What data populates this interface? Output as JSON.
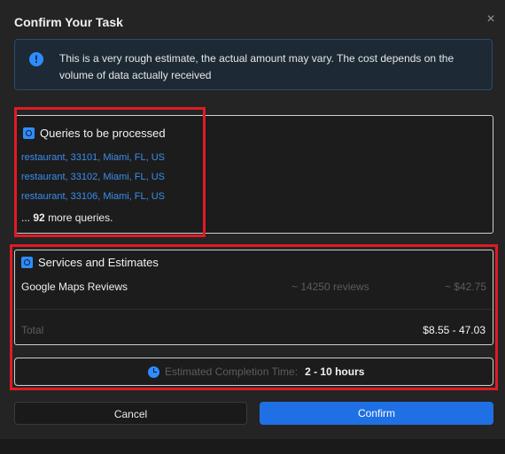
{
  "dialog": {
    "title": "Confirm Your Task",
    "close_icon": "×"
  },
  "info": {
    "icon": "!",
    "text": "This is a very rough estimate, the actual amount may vary. The cost depends on the volume of data actually received"
  },
  "queries": {
    "heading": "Queries to be processed",
    "items": [
      "restaurant, 33101, Miami, FL, US",
      "restaurant, 33102, Miami, FL, US",
      "restaurant, 33106, Miami, FL, US"
    ],
    "more_count": "92",
    "more_prefix": "...",
    "more_suffix": "more queries."
  },
  "services": {
    "heading": "Services and Estimates",
    "rows": [
      {
        "name": "Google Maps Reviews",
        "reviews": "~ 14250 reviews",
        "cost": "~ $42.75"
      }
    ],
    "total_label": "Total",
    "total_value": "$8.55 - 47.03"
  },
  "eta": {
    "label": "Estimated Completion Time:",
    "value": "2 - 10 hours"
  },
  "buttons": {
    "cancel": "Cancel",
    "confirm": "Confirm"
  },
  "colors": {
    "accent": "#1f6fe5",
    "link": "#3b8ef0",
    "highlight": "#e01b24"
  }
}
